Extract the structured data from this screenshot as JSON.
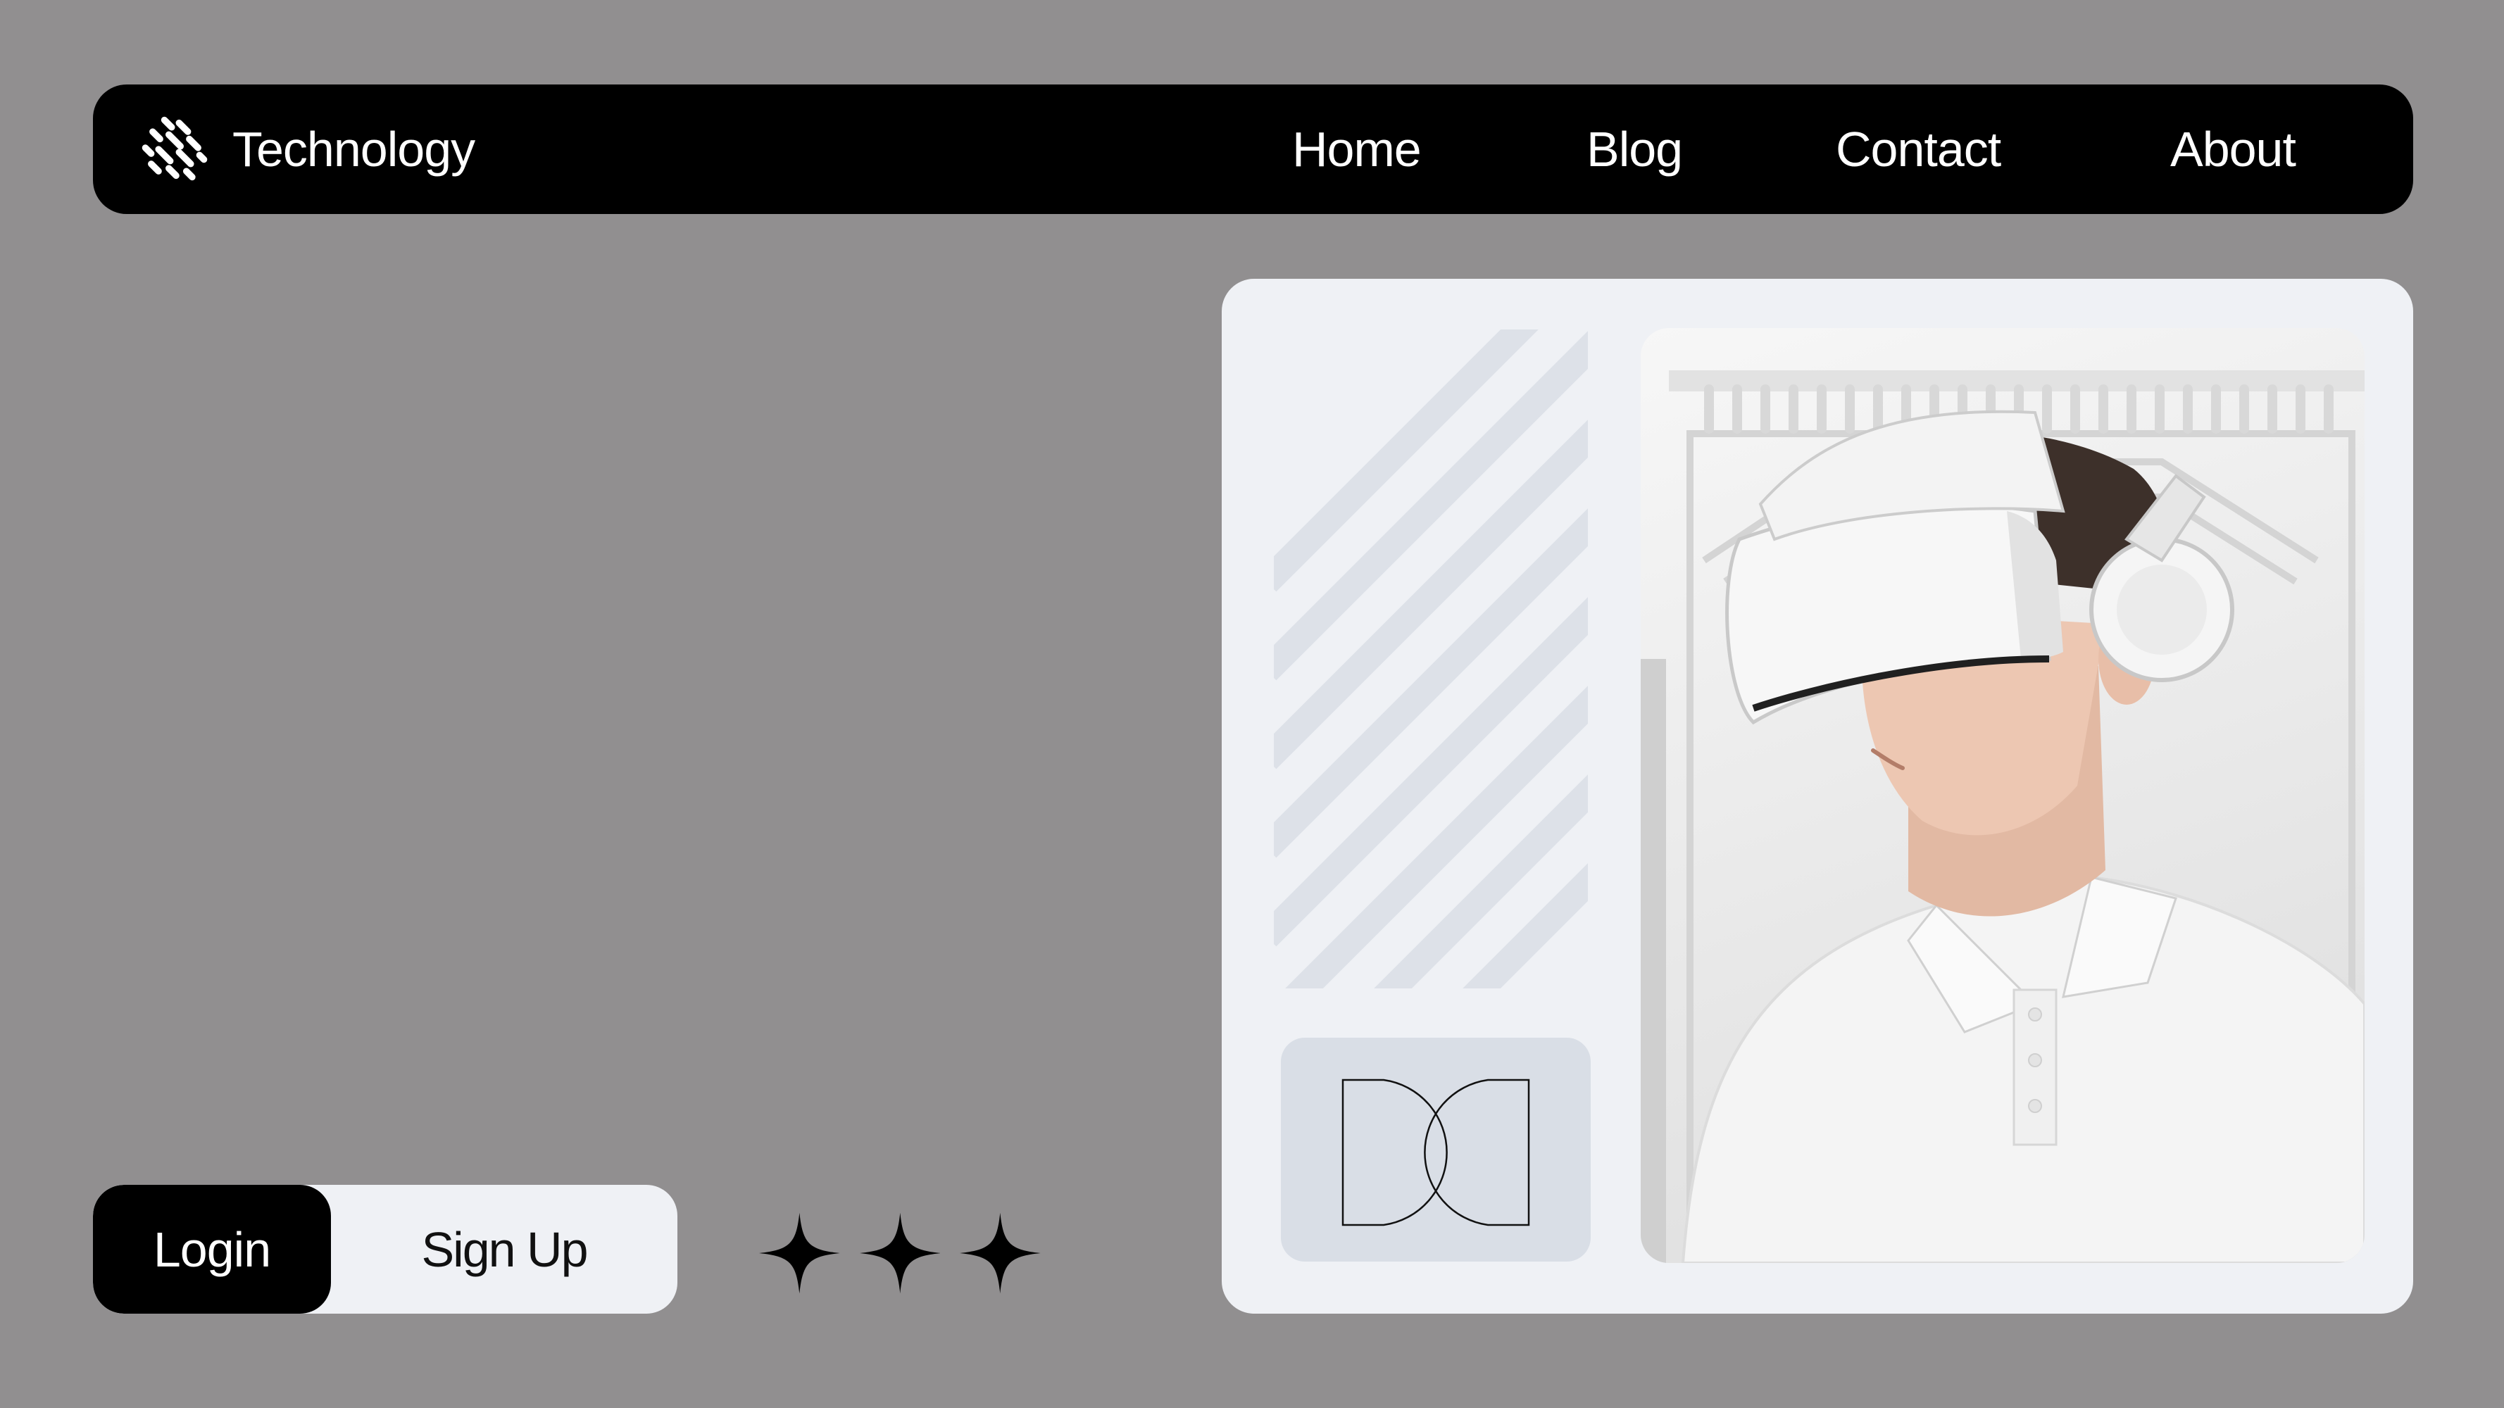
{
  "navbar": {
    "brand": {
      "name": "Technology",
      "logo_icon": "scattered-dash-logo-icon"
    },
    "links": [
      {
        "label": "Home"
      },
      {
        "label": "Blog"
      },
      {
        "label": "Contact"
      },
      {
        "label": "About"
      }
    ]
  },
  "hero": {
    "decor_icon": "diagonal-stripes-pattern",
    "monogram_icon": "monogram-dc-outline-icon",
    "image": "person-wearing-white-vr-headset-photo"
  },
  "auth": {
    "login_label": "Login",
    "signup_label": "Sign Up",
    "active": "Login"
  },
  "decoration": {
    "sparkle_icon": "four-point-star-icon",
    "sparkle_count": 3
  },
  "colors": {
    "background": "#918f90",
    "navbar": "#000000",
    "card": "#eff1f5",
    "stripe": "#dde1e8",
    "monogram_tile": "#d9dee6",
    "text_light": "#ffffff",
    "text_dark": "#111111"
  }
}
